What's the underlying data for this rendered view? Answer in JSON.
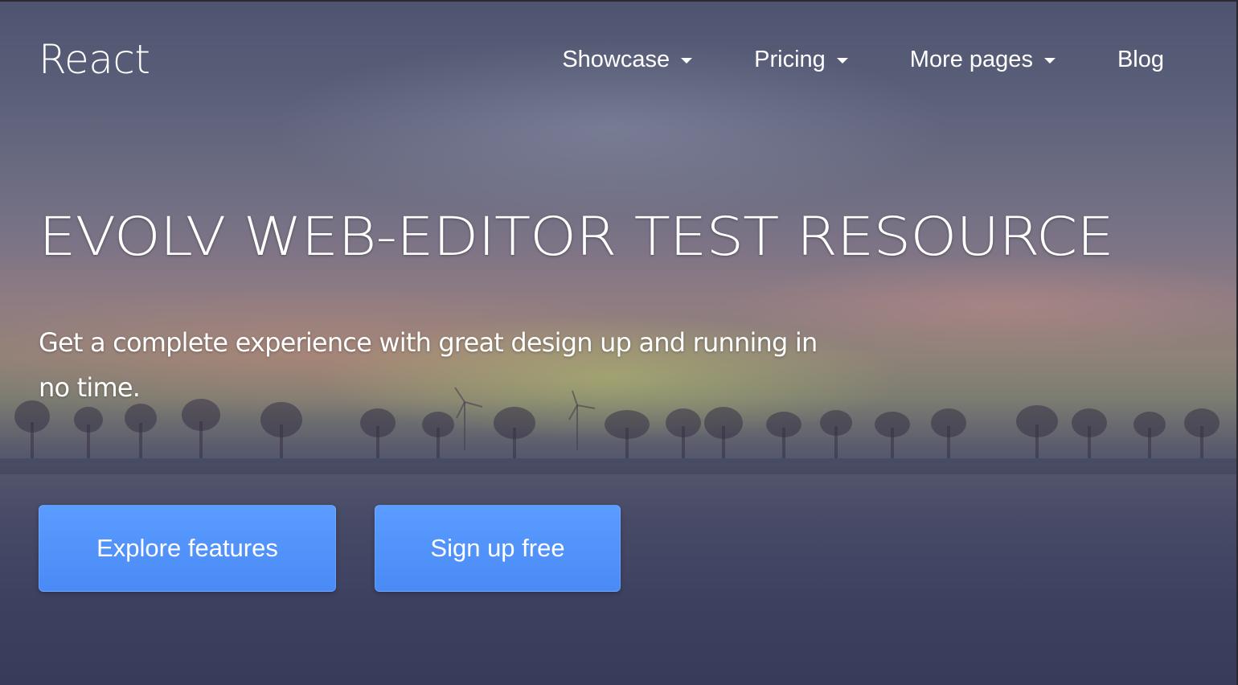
{
  "nav": {
    "brand": "React",
    "items": [
      {
        "label": "Showcase",
        "has_dropdown": true
      },
      {
        "label": "Pricing",
        "has_dropdown": true
      },
      {
        "label": "More pages",
        "has_dropdown": true
      },
      {
        "label": "Blog",
        "has_dropdown": false
      }
    ]
  },
  "hero": {
    "title": "EVOLV WEB-EDITOR TEST RESOURCE",
    "subtitle": "Get a complete experience with great design up and running in no time.",
    "buttons": [
      {
        "label": "Explore features"
      },
      {
        "label": "Sign up free"
      }
    ]
  },
  "colors": {
    "button_primary": "#4a8af6",
    "text": "#ffffff"
  }
}
